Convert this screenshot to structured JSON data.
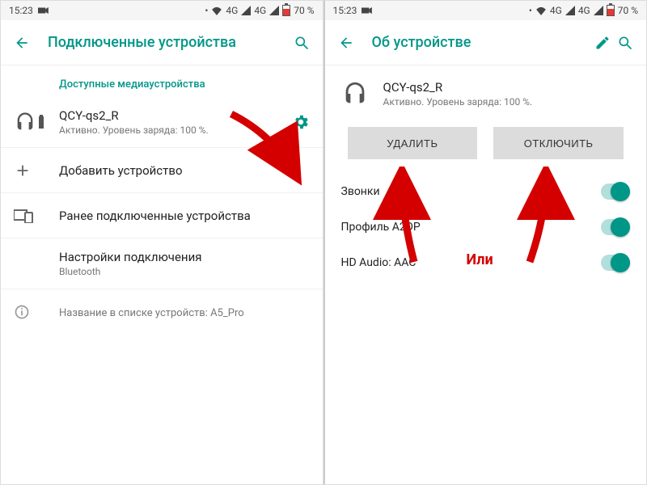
{
  "statusbar": {
    "time": "15:23",
    "signal": "4G",
    "battery": "70 %"
  },
  "left": {
    "title": "Подключенные устройства",
    "section_available": "Доступные медиаустройства",
    "device": {
      "name": "QCY-qs2_R",
      "status": "Активно. Уровень заряда: 100 %."
    },
    "add_device": "Добавить устройство",
    "previous": "Ранее подключенные устройства",
    "conn_settings": "Настройки подключения",
    "conn_settings_sub": "Bluetooth",
    "footer": "Название в списке устройств: A5_Pro"
  },
  "right": {
    "title": "Об устройстве",
    "device": {
      "name": "QCY-qs2_R",
      "status": "Активно. Уровень заряда: 100 %."
    },
    "delete": "УДАЛИТЬ",
    "disconnect": "ОТКЛЮЧИТЬ",
    "toggles": {
      "calls": "Звонки",
      "a2dp": "Профиль A2DP",
      "hd": "HD Audio: AAC"
    },
    "or": "Или"
  }
}
